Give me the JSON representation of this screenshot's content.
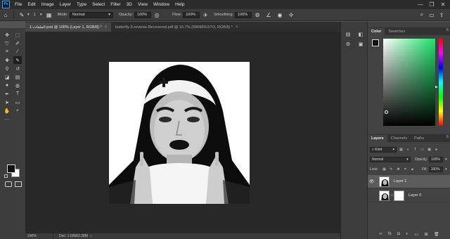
{
  "menu": [
    "File",
    "Edit",
    "Image",
    "Layer",
    "Type",
    "Select",
    "Filter",
    "3D",
    "View",
    "Window",
    "Help"
  ],
  "window_controls": [
    "—",
    "❐",
    "✕"
  ],
  "options": {
    "mode_label": "Mode:",
    "mode_value": "Normal",
    "opacity_label": "Opacity:",
    "opacity_value": "100%",
    "flow_label": "Flow:",
    "flow_value": "100%",
    "smoothing_label": "Smoothing:",
    "smoothing_value": "100%",
    "brush_size": "1"
  },
  "tabs": [
    {
      "label": "1-الملفات.psd @ 100% (Layer 1, RGB/8) *",
      "active": true
    },
    {
      "label": "butterfly-3-reverse-Recovered.pdf @ 16.7% (MANIFESTO, RGB/8) *",
      "active": false
    }
  ],
  "status": {
    "zoom": "100%",
    "doc": "Doc: 1.02M/2.38M"
  },
  "color_panel": {
    "tabs": [
      "Color",
      "Swatches"
    ]
  },
  "layers_panel": {
    "tabs": [
      "Layers",
      "Channels",
      "Paths"
    ],
    "kind_label": "Kind",
    "blend_mode": "Normal",
    "opacity_label": "Opacity:",
    "opacity_value": "100%",
    "lock_label": "Lock:",
    "fill_label": "Fill:",
    "fill_value": "100%",
    "layers": [
      {
        "name": "Layer 1",
        "selected": true,
        "visible": true
      },
      {
        "name": "Layer 0",
        "selected": false,
        "visible": false
      }
    ],
    "footer_icons": [
      "link-icon",
      "fx-icon",
      "mask-icon",
      "adjustment-icon",
      "group-icon",
      "new-layer-icon",
      "trash-icon"
    ]
  }
}
